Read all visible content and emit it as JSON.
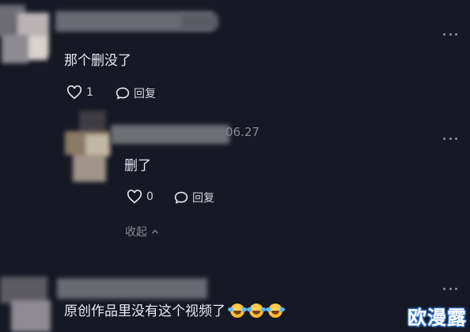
{
  "comments": [
    {
      "text": "那个删没了",
      "likes": "1",
      "reply_label": "回复"
    },
    {
      "date_fragment": "06.27",
      "text": "删了",
      "likes": "0",
      "reply_label": "回复",
      "collapse_label": "收起"
    },
    {
      "text": "原创作品里没有这个视频了"
    }
  ],
  "icons": {
    "like": "heart-outline-icon",
    "reply": "speech-bubble-icon",
    "more": "more-dots-icon",
    "collapse": "chevron-up-icon",
    "emoji": "laughing-tears-emoji"
  },
  "watermark": "欧漫露",
  "colors": {
    "background": "#161823",
    "text": "#eceaf0",
    "muted": "#8a8a93",
    "watermark_outline": "#3a7bd5"
  }
}
